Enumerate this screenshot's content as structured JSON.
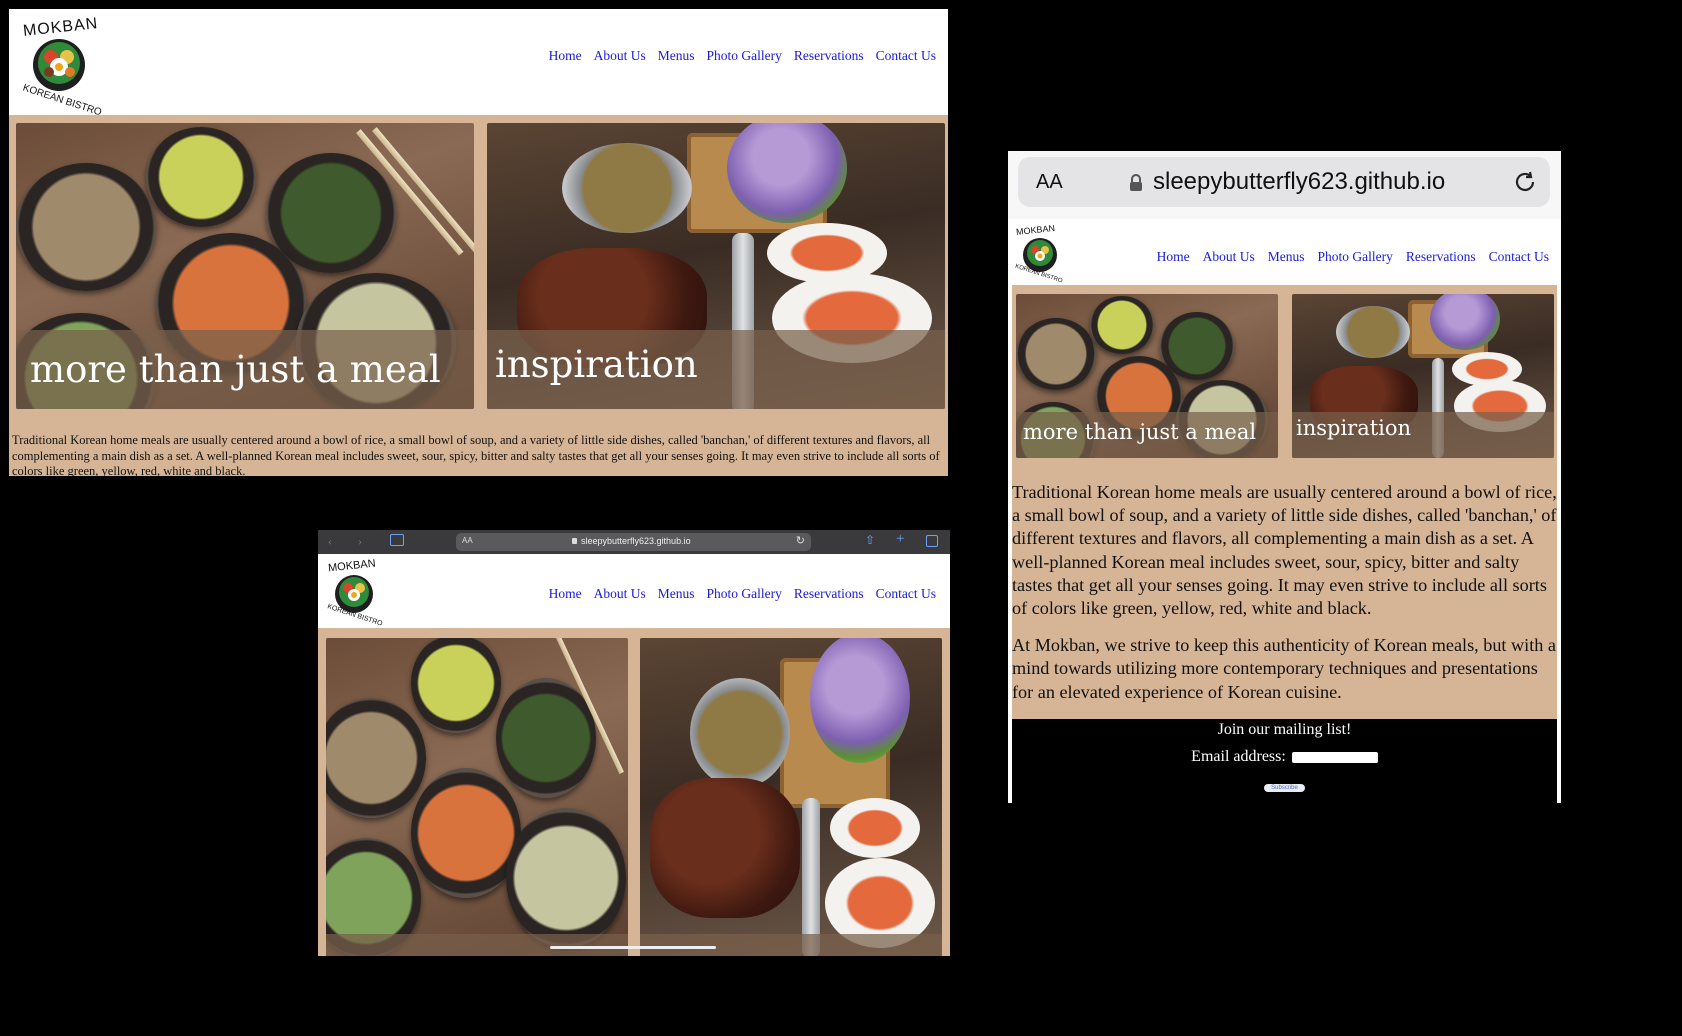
{
  "site": {
    "logo_top": "MOKBAN",
    "logo_bottom": "KOREAN BISTRO",
    "nav": [
      "Home",
      "About Us",
      "Menus",
      "Photo Gallery",
      "Reservations",
      "Contact Us"
    ],
    "caption_left": "more than just a meal",
    "caption_right": "inspiration",
    "desc_p1": "Traditional Korean home meals are usually centered around a bowl of rice, a small bowl of soup, and a variety of little side dishes, called 'banchan,' of different textures and flavors, all complementing a main dish as a set. A well-planned Korean meal includes sweet, sour, spicy, bitter and salty tastes that get all your senses going. It may even strive to include all sorts of colors like green, yellow, red, white and black.",
    "desc_p2": "At Mokban, we strive to keep this authenticity of Korean meals, but with a mind towards utilizing more contemporary techniques and presentations for an elevated experience of Korean cuisine.",
    "mailing_title": "Join our mailing list!",
    "email_label": "Email address:",
    "subscribe_label": "Subscribe"
  },
  "browser": {
    "url": "sleepybutterfly623.github.io",
    "text_size_label": "AA"
  },
  "colors": {
    "content_bg": "#d6b596",
    "nav_link": "#1a1adb",
    "page_bg": "#000000"
  }
}
